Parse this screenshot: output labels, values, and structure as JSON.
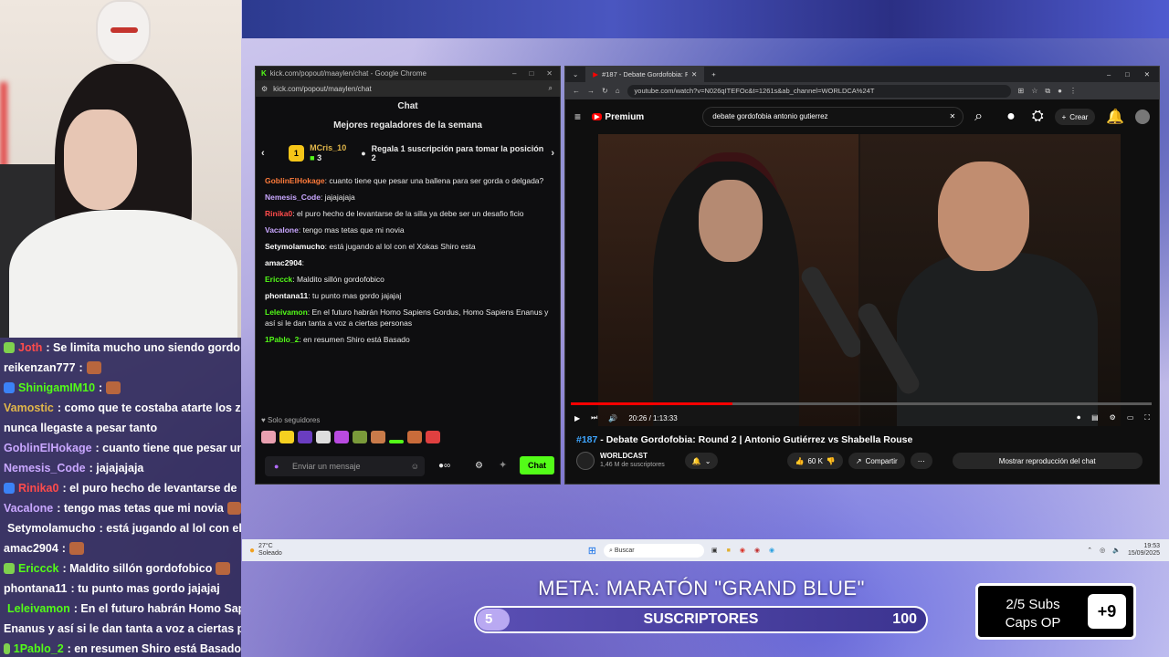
{
  "overlay_chat": [
    {
      "user": "Joth",
      "text": ": Se limita mucho uno siendo gordo",
      "color": "#ff4b4b",
      "badge": "#7fd14e",
      "emote": false
    },
    {
      "user": "reikenzan777",
      "text": " :",
      "color": "#ffffff",
      "badge": "",
      "emote": true
    },
    {
      "user": "ShinigamIM10",
      "text": " :",
      "color": "#53fc18",
      "badge": "#3b82f6",
      "emote": true
    },
    {
      "user": "Vamostic",
      "text": ": como que te costaba atarte los za",
      "color": "#e0b64a",
      "badge": "",
      "emote": false
    },
    {
      "user": "",
      "text": "nunca llegaste a pesar tanto",
      "color": "#ffffff",
      "badge": "",
      "emote": false
    },
    {
      "user": "GoblinElHokage",
      "text": ": cuanto tiene que pesar una",
      "color": "#c9a7ff",
      "badge": "",
      "emote": false
    },
    {
      "user": "Nemesis_Code",
      "text": ": jajajajaja",
      "color": "#c9a7ff",
      "badge": "",
      "emote": false
    },
    {
      "user": "Rinika0",
      "text": ": el puro hecho de levantarse de",
      "color": "#ff4b4b",
      "badge": "#3b82f6",
      "emote": false
    },
    {
      "user": "Vacalone",
      "text": ": tengo mas tetas que mi novia",
      "color": "#c9a7ff",
      "badge": "",
      "emote": true
    },
    {
      "user": "Setymolamucho",
      "text": ": está jugando al lol con el",
      "color": "#ffffff",
      "badge": "#3b82f6",
      "emote": false
    },
    {
      "user": "amac2904",
      "text": " :",
      "color": "#ffffff",
      "badge": "",
      "emote": true
    },
    {
      "user": "Ericcck",
      "text": ": Maldito sillón gordofobico",
      "color": "#53fc18",
      "badge": "#7fd14e",
      "emote": true
    },
    {
      "user": "phontana11",
      "text": ": tu punto mas gordo jajajaj",
      "color": "#ffffff",
      "badge": "",
      "emote": false
    },
    {
      "user": "Leleivamon",
      "text": ": En el futuro habrán Homo Sap",
      "color": "#53fc18",
      "badge": "#7fd14e",
      "emote": false
    },
    {
      "user": "",
      "text": "Enanus y así si le dan tanta a voz a ciertas per",
      "color": "#ffffff",
      "badge": "",
      "emote": false
    },
    {
      "user": "1Pablo_2",
      "text": ": en resumen Shiro está Basado",
      "color": "#53fc18",
      "badge": "#7fd14e",
      "emote": false
    }
  ],
  "kick": {
    "window_title": "kick.com/popout/maaylen/chat - Google Chrome",
    "url": "kick.com/popout/maaylen/chat",
    "header": "Chat",
    "top_gifters": "Mejores regaladores de la semana",
    "gifter_name": "MCris_10",
    "gifter_count": "3",
    "gifter_rank": "1",
    "gift_cta": "Regala 1 suscripción para tomar la posición 2",
    "messages": [
      {
        "user": "GoblinElHokage",
        "text": ": cuanto tiene que pesar una ballena para ser gorda o delgada?",
        "color": "#ff7b3b"
      },
      {
        "user": "Nemesis_Code",
        "text": ": jajajajaja",
        "color": "#c9a7ff"
      },
      {
        "user": "Rinika0",
        "text": ": el puro hecho de levantarse de la silla ya debe ser un desafio ficio",
        "color": "#ff4b4b"
      },
      {
        "user": "Vacalone",
        "text": ": tengo mas tetas que mi novia",
        "color": "#c9a7ff"
      },
      {
        "user": "Setymolamucho",
        "text": ": está jugando al lol con el Xokas Shiro esta",
        "color": "#ffffff"
      },
      {
        "user": "amac2904",
        "text": ":",
        "color": "#ffffff"
      },
      {
        "user": "Ericcck",
        "text": ": Maldito sillón gordofobico",
        "color": "#53fc18"
      },
      {
        "user": "phontana11",
        "text": ": tu punto mas gordo jajajaj",
        "color": "#ffffff"
      },
      {
        "user": "Leleivamon",
        "text": ": En el futuro habrán Homo Sapiens Gordus, Homo Sapiens Enanus y así si le dan tanta a voz a ciertas personas",
        "color": "#53fc18"
      },
      {
        "user": "1Pablo_2",
        "text": ": en resumen Shiro está Basado",
        "color": "#53fc18"
      }
    ],
    "followers_only": "Solo seguidores",
    "input_placeholder": "Enviar un mensaje",
    "chat_button": "Chat"
  },
  "youtube": {
    "tab_title": "#187 - Debate Gordofobia: Ro",
    "url": "youtube.com/watch?v=N026qITEFOc&t=1261s&ab_channel=WORLDCA%24T",
    "logo": "Premium",
    "search_value": "debate gordofobia antonio gutierrez",
    "create": "Crear",
    "time": "20:26 / 1:13:33",
    "progress": 0.278,
    "title_prefix": "#187",
    "title": " - Debate Gordofobia: Round 2 | Antonio Gutiérrez vs Shabella Rouse",
    "channel": "WORLDCAST",
    "subscribers": "1,46 M de suscriptores",
    "likes": "60 K",
    "share": "Compartir",
    "show_chat": "Mostrar reproducción del chat"
  },
  "taskbar": {
    "weather_temp": "27°C",
    "weather_desc": "Soleado",
    "search": "Buscar",
    "time": "19:53",
    "date": "15/09/2025"
  },
  "goal": {
    "meta": "META: MARATÓN \"GRAND BLUE\"",
    "current": "5",
    "label": "SUSCRIPTORES",
    "max": "100",
    "progress": 0.05
  },
  "subs_box": {
    "line1": "2/5 Subs",
    "line2": "Caps OP",
    "plus": "+9"
  }
}
